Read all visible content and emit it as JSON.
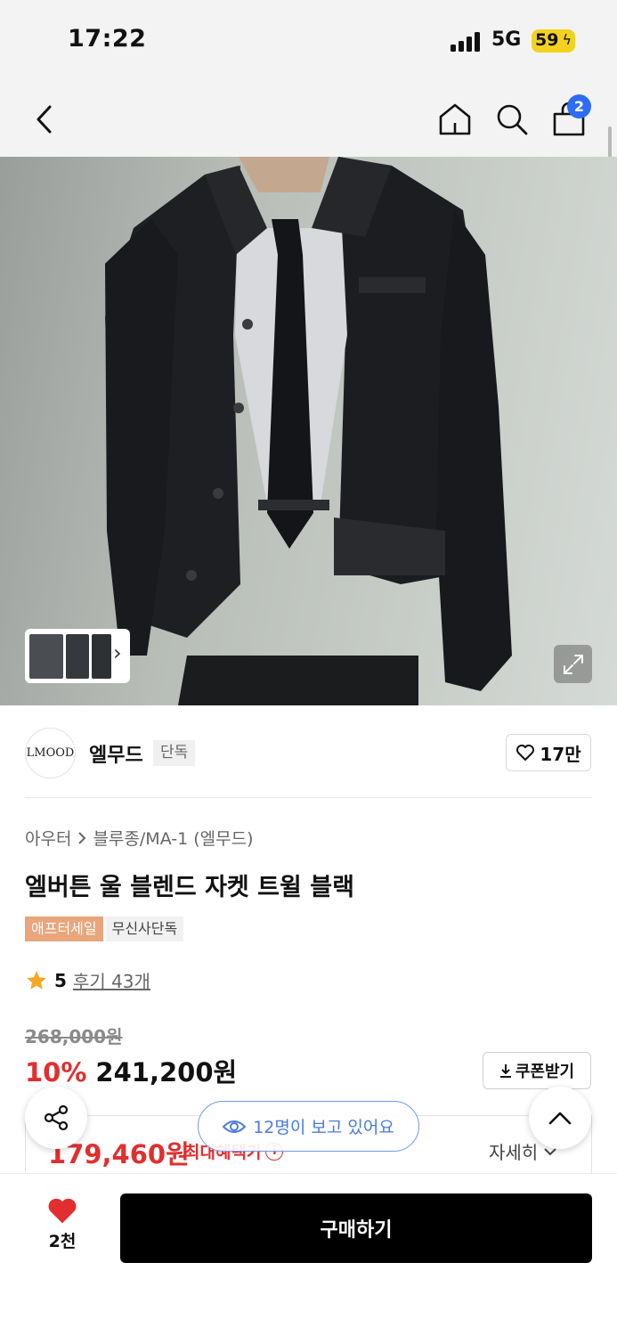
{
  "status_bar": {
    "time": "17:22",
    "network": "5G",
    "battery": "59"
  },
  "nav": {
    "cart_count": "2",
    "icons": [
      "back-icon",
      "home-icon",
      "search-icon",
      "cart-icon"
    ]
  },
  "gallery": {
    "thumb_arrow": "›"
  },
  "brand": {
    "logo_text": "LMOOD",
    "name": "엘무드",
    "tag": "단독",
    "likes": "17만"
  },
  "product": {
    "breadcrumb": [
      "아우터",
      "블루종/MA-1 (엘무드)"
    ],
    "title": "엘버튼 울 블렌드 자켓 트윌 블랙",
    "badges": [
      "애프터세일",
      "무신사단독"
    ],
    "rating": "5",
    "reviews": "후기 43개",
    "original_price": "268,000원",
    "discount": "10%",
    "price": "241,200원",
    "coupon_label": "쿠폰받기",
    "benefit_price": "179,460원",
    "benefit_label": "최대혜택가",
    "detail_label": "자세히"
  },
  "floating": {
    "viewers": "12명이 보고 있어요"
  },
  "bottom": {
    "wish_count": "2천",
    "buy_label": "구매하기"
  },
  "colors": {
    "accent_red": "#e22e2e",
    "badge_orange": "#e9a57b",
    "cart_badge": "#2e6cf6",
    "viewers_blue": "#4a7be0"
  }
}
